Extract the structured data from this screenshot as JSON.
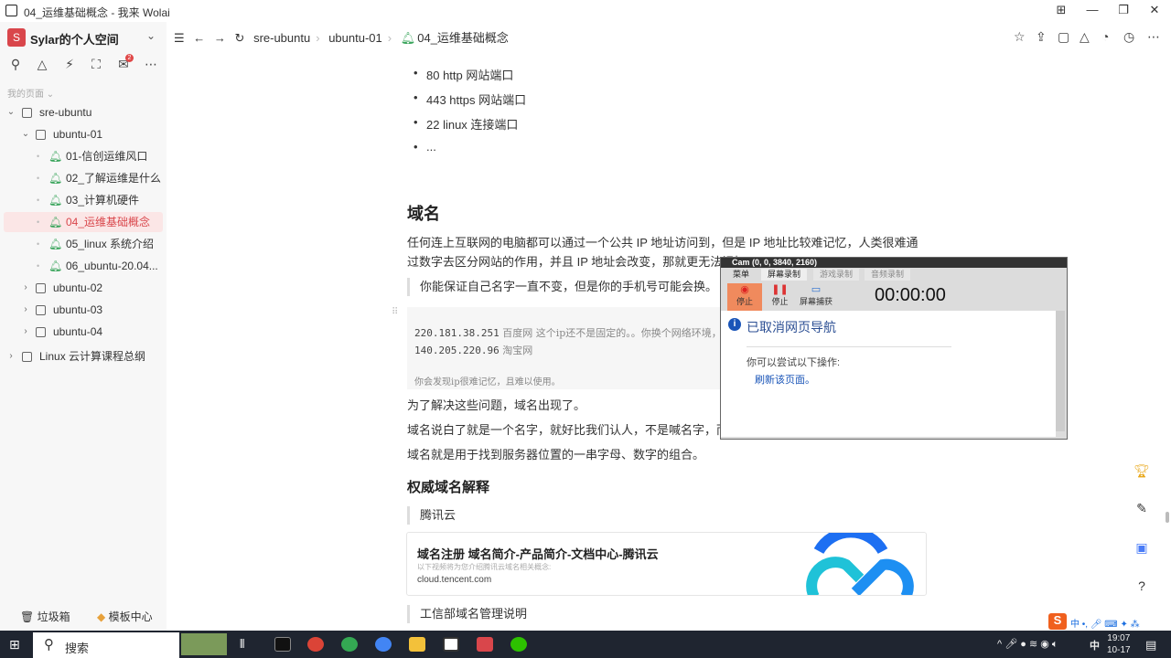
{
  "window": {
    "title": "04_运维基础概念 - 我来 Wolai"
  },
  "sidebar": {
    "workspace_initial": "S",
    "workspace_name": "Sylar的个人空间",
    "my_pages": "我的页面 ⌄",
    "notification_count": "2",
    "tree": [
      {
        "label": "sre-ubuntu"
      },
      {
        "label": "ubuntu-01"
      },
      {
        "label": "01-信创运维风口"
      },
      {
        "label": "02_了解运维是什么"
      },
      {
        "label": "03_计算机硬件"
      },
      {
        "label": "04_运维基础概念"
      },
      {
        "label": "05_linux 系统介绍"
      },
      {
        "label": "06_ubuntu-20.04..."
      },
      {
        "label": "ubuntu-02"
      },
      {
        "label": "ubuntu-03"
      },
      {
        "label": "ubuntu-04"
      },
      {
        "label": "Linux 云计算课程总纲"
      }
    ],
    "trash": "垃圾箱",
    "templates": "模板中心"
  },
  "breadcrumb": [
    "sre-ubuntu",
    "ubuntu-01",
    "04_运维基础概念"
  ],
  "doc": {
    "ports": [
      "80  http 网站端口",
      "443 https 网站端口",
      "22  linux 连接端口",
      "..."
    ],
    "h_domain": "域名",
    "p1": "任何连上互联网的电脑都可以通过一个公共 IP 地址访问到，但是 IP 地址比较难记忆，人类很难通过数字去区分网站的作用，并且 IP 地址会改变，那就更无法记忆了。",
    "quote1": "你能保证自己名字一直不变，但是你的手机号可能会换。",
    "code_ip1": "220.181.38.251",
    "code_c1": " 百度网  这个ip还不是固定的。。你换个网络环境，",
    "code_ip2": "140.205.220.96",
    "code_c2": " 淘宝网",
    "code_note": "你会发现ip很难记忆，且难以使用。",
    "p2": "为了解决这些问题，域名出现了。",
    "p3": "域名说白了就是一个名字，就好比我们认人，不是喊名字，而是喊",
    "p4": "域名就是用于找到服务器位置的一串字母、数字的组合。",
    "h_auth": "权威域名解释",
    "quote2": "腾讯云",
    "card_title": "域名注册 域名简介-产品简介-文档中心-腾讯云",
    "card_desc": "以下视频将为您介绍腾讯云域名相关概念:",
    "card_url": "cloud.tencent.com",
    "quote3": "工信部域名管理说明"
  },
  "cam": {
    "caption": "Cam (0, 0, 3840, 2160)",
    "tabs": [
      "菜单",
      "屏幕录制",
      "游戏录制",
      "音频录制"
    ],
    "buttons": [
      "停止",
      "停止",
      "屏幕捕获"
    ],
    "timer": "00:00:00",
    "dialog_title": "已取消网页导航",
    "dialog_text": "你可以尝试以下操作:",
    "dialog_link": "刷新该页面。"
  },
  "taskbar": {
    "search": "搜索",
    "ime": "中",
    "time": "19:07",
    "date": "10-17"
  },
  "colors": {
    "accent": "#d9464b",
    "green": "#3aa55c"
  }
}
